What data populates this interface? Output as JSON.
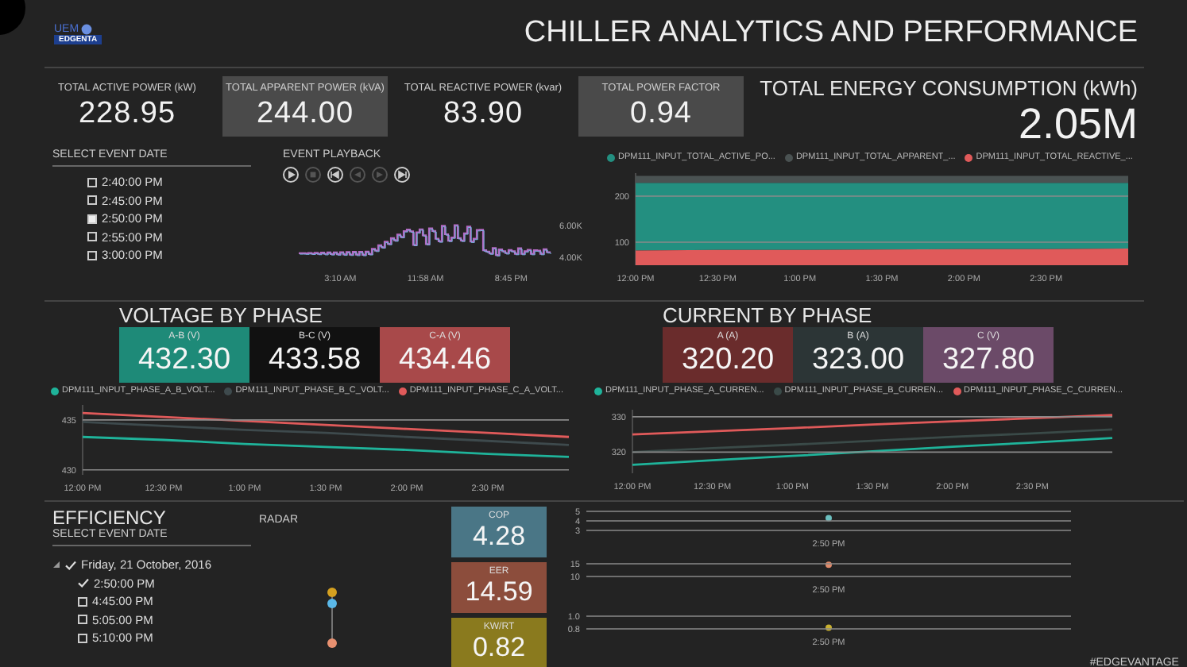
{
  "header": {
    "logo_top": "UEM",
    "logo_bottom": "EDGENTA",
    "title": "CHILLER ANALYTICS AND PERFORMANCE"
  },
  "kpis": [
    {
      "label": "TOTAL ACTIVE POWER (kW)",
      "value": "228.95",
      "highlighted": false
    },
    {
      "label": "TOTAL APPARENT POWER (kVA)",
      "value": "244.00",
      "highlighted": true
    },
    {
      "label": "TOTAL REACTIVE POWER (kvar)",
      "value": "83.90",
      "highlighted": false
    },
    {
      "label": "TOTAL POWER FACTOR",
      "value": "0.94",
      "highlighted": true
    }
  ],
  "energy": {
    "label": "TOTAL ENERGY CONSUMPTION (kWh)",
    "value": "2.05M"
  },
  "event_dates": {
    "title": "SELECT EVENT DATE",
    "items": [
      {
        "label": "2:40:00 PM",
        "checked": false
      },
      {
        "label": "2:45:00 PM",
        "checked": false
      },
      {
        "label": "2:50:00 PM",
        "checked": true
      },
      {
        "label": "2:55:00 PM",
        "checked": false
      },
      {
        "label": "3:00:00 PM",
        "checked": false
      }
    ]
  },
  "playback": {
    "title": "EVENT PLAYBACK",
    "buttons": [
      {
        "kind": "play",
        "disabled": false
      },
      {
        "kind": "stop",
        "disabled": true
      },
      {
        "kind": "skip_back",
        "disabled": false
      },
      {
        "kind": "step_back",
        "disabled": true
      },
      {
        "kind": "step_forward",
        "disabled": true
      },
      {
        "kind": "skip_forward",
        "disabled": false
      }
    ],
    "y_labels": [
      "6.00K",
      "4.00K"
    ],
    "x_labels": [
      "3:10 AM",
      "11:58 AM",
      "8:45 PM"
    ]
  },
  "power": {
    "chart_data": {
      "type": "area",
      "categories": [
        "12:00 PM",
        "12:30 PM",
        "1:00 PM",
        "1:30 PM",
        "2:00 PM",
        "2:30 PM",
        null
      ],
      "ylim": [
        50,
        250
      ],
      "yticks": [
        100,
        200
      ],
      "series": [
        {
          "name": "DPM111_INPUT_TOTAL_ACTIVE_PO...",
          "color": "#238f80",
          "values": [
            229,
            229,
            229,
            229,
            229,
            229,
            229
          ]
        },
        {
          "name": "DPM111_INPUT_TOTAL_APPARENT_...",
          "color": "#4a5252",
          "values": [
            244,
            244,
            244,
            244,
            244,
            244,
            244
          ]
        },
        {
          "name": "DPM111_INPUT_TOTAL_REACTIVE_...",
          "color": "#e05a5a",
          "values": [
            82,
            83,
            83,
            84,
            85,
            85,
            86
          ]
        }
      ]
    }
  },
  "voltage": {
    "title": "VOLTAGE BY PHASE",
    "cards": [
      {
        "label": "A-B (V)",
        "value": "432.30",
        "color": "#1e8a78"
      },
      {
        "label": "B-C (V)",
        "value": "433.58",
        "color": "#111111"
      },
      {
        "label": "C-A (V)",
        "value": "434.46",
        "color": "#a8494a"
      }
    ],
    "chart_data": {
      "type": "line",
      "categories": [
        "12:00 PM",
        "12:30 PM",
        "1:00 PM",
        "1:30 PM",
        "2:00 PM",
        "2:30 PM",
        null
      ],
      "ylim": [
        429.5,
        436.5
      ],
      "yticks": [
        430,
        435
      ],
      "series": [
        {
          "name": "DPM111_INPUT_PHASE_A_B_VOLT...",
          "color": "#1fb39a",
          "values": [
            433.3,
            433,
            432.6,
            432.3,
            432,
            431.6,
            431.3
          ]
        },
        {
          "name": "DPM111_INPUT_PHASE_B_C_VOLT...",
          "color": "#3e4a4d",
          "values": [
            434.8,
            434.4,
            434,
            433.7,
            433.3,
            432.9,
            432.5
          ]
        },
        {
          "name": "DPM111_INPUT_PHASE_C_A_VOLT...",
          "color": "#e05a5a",
          "values": [
            435.7,
            435.3,
            434.9,
            434.5,
            434.1,
            433.7,
            433.3
          ]
        }
      ]
    }
  },
  "current": {
    "title": "CURRENT BY PHASE",
    "cards": [
      {
        "label": "A (A)",
        "value": "320.20",
        "color": "#6a2c2c"
      },
      {
        "label": "B (A)",
        "value": "323.00",
        "color": "#2c3536"
      },
      {
        "label": "C (V)",
        "value": "327.80",
        "color": "#6b4a68"
      }
    ],
    "chart_data": {
      "type": "line",
      "categories": [
        "12:00 PM",
        "12:30 PM",
        "1:00 PM",
        "1:30 PM",
        "2:00 PM",
        "2:30 PM",
        null
      ],
      "ylim": [
        314,
        332
      ],
      "yticks": [
        320,
        330
      ],
      "series": [
        {
          "name": "DPM111_INPUT_PHASE_A_CURREN...",
          "color": "#1fb39a",
          "values": [
            316.4,
            317.7,
            318.9,
            320.2,
            321.5,
            322.7,
            324
          ]
        },
        {
          "name": "DPM111_INPUT_PHASE_B_CURREN...",
          "color": "#3a4a48",
          "values": [
            320,
            321.1,
            322.1,
            323.2,
            324.3,
            325.3,
            326.4
          ]
        },
        {
          "name": "DPM111_INPUT_PHASE_C_CURREN...",
          "color": "#e05a5a",
          "values": [
            325,
            325.9,
            326.8,
            327.8,
            328.7,
            329.6,
            330.5
          ]
        }
      ]
    }
  },
  "efficiency": {
    "title": "EFFICIENCY",
    "subtitle": "SELECT EVENT DATE",
    "tree": [
      {
        "label": "Friday, 21 October, 2016",
        "expanded": true,
        "checked": true,
        "children": [
          {
            "label": "2:50:00 PM",
            "checked": true
          },
          {
            "label": "4:45:00 PM",
            "checked": false
          },
          {
            "label": "5:05:00 PM",
            "checked": false
          },
          {
            "label": "5:10:00 PM",
            "checked": false
          }
        ]
      }
    ],
    "radar_title": "RADAR",
    "metrics": [
      {
        "label": "COP",
        "value": "4.28",
        "color": "#4a7686"
      },
      {
        "label": "EER",
        "value": "14.59",
        "color": "#8c4d3c"
      },
      {
        "label": "KW/RT",
        "value": "0.82",
        "color": "#8a7a1e"
      }
    ],
    "trend_charts": [
      {
        "chart_data": {
          "type": "scatter",
          "categories": [
            "2:50 PM"
          ],
          "ylim": [
            3,
            5
          ],
          "yticks": [
            3,
            4,
            5
          ],
          "series": [
            {
              "color": "#6cc0c0",
              "values": [
                4.3
              ]
            }
          ]
        }
      },
      {
        "chart_data": {
          "type": "scatter",
          "categories": [
            "2:50 PM"
          ],
          "ylim": [
            10,
            15
          ],
          "yticks": [
            10,
            15
          ],
          "series": [
            {
              "color": "#e08a6a",
              "values": [
                14.6
              ]
            }
          ]
        }
      },
      {
        "chart_data": {
          "type": "scatter",
          "categories": [
            "2:50 PM"
          ],
          "ylim": [
            0.8,
            1.0
          ],
          "yticks": [
            {
              "value": 0.8,
              "label": "0.8"
            },
            {
              "value": 1.0,
              "label": "1.0"
            }
          ],
          "series": [
            {
              "color": "#c8b030",
              "values": [
                0.82
              ]
            }
          ]
        }
      }
    ]
  },
  "hashtag": "#EDGEVANTAGE"
}
